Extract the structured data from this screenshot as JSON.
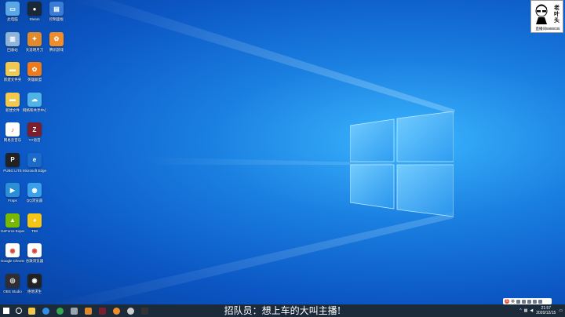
{
  "desktop_icons": [
    {
      "label": "此电脑",
      "color": "#5aa7e8",
      "glyph": "▭"
    },
    {
      "label": "Steam",
      "color": "#1b2838",
      "glyph": "●"
    },
    {
      "label": "控制面板",
      "color": "#3a7bd5",
      "glyph": "▤"
    },
    {
      "label": "回收站",
      "color": "#8fb3d9",
      "glyph": "▥"
    },
    {
      "label": "天涯明月刀",
      "color": "#e08a2c",
      "glyph": "✦"
    },
    {
      "label": "腾讯游戏",
      "color": "#f08c2a",
      "glyph": "✿"
    },
    {
      "label": "新建文件夹",
      "color": "#f2c94c",
      "glyph": "▬"
    },
    {
      "label": "英雄联盟",
      "color": "#f07a1a",
      "glyph": "✿"
    },
    {
      "label": "新建文件",
      "color": "#f2c94c",
      "glyph": "▬"
    },
    {
      "label": "网络和共享中心",
      "color": "#4fb3e8",
      "glyph": "☁"
    },
    {
      "label": "网易云音乐",
      "color": "#ffffff",
      "glyph": "♪"
    },
    {
      "label": "YY语音",
      "color": "#7a1f2e",
      "glyph": "Z"
    },
    {
      "label": "PUBG LITE",
      "color": "#222222",
      "glyph": "P"
    },
    {
      "label": "Microsoft Edge",
      "color": "#1b6ac9",
      "glyph": "e"
    },
    {
      "label": "Fraps",
      "color": "#2a8fd6",
      "glyph": "▶"
    },
    {
      "label": "QQ浏览器",
      "color": "#3aa0e8",
      "glyph": "◉"
    },
    {
      "label": "GeForce Experience",
      "color": "#76b900",
      "glyph": "▲"
    },
    {
      "label": "TIM",
      "color": "#f5c518",
      "glyph": "◕"
    },
    {
      "label": "Google Chrome",
      "color": "#ffffff",
      "glyph": "◉"
    },
    {
      "label": "谷歌浏览器",
      "color": "#ffffff",
      "glyph": "◉"
    },
    {
      "label": "OBS Studio",
      "color": "#302e31",
      "glyph": "◎"
    },
    {
      "label": "绝地求生",
      "color": "#222222",
      "glyph": "◉"
    }
  ],
  "avatar": {
    "name": "老叶头",
    "id": "直播间5988035"
  },
  "subtitle": "招队员：想上车的大叫主播!",
  "tray": {
    "time": "21:57",
    "date": "2020/12/15",
    "ime": "英"
  },
  "taskbar": {
    "apps": [
      {
        "name": "start",
        "color": "#ffffff"
      },
      {
        "name": "search",
        "color": "#ffffff"
      },
      {
        "name": "file-explorer",
        "color": "#f2c94c"
      },
      {
        "name": "edge",
        "color": "#2f8fe8"
      },
      {
        "name": "chrome",
        "color": "#34a853"
      },
      {
        "name": "steam",
        "color": "#9aa6b2"
      },
      {
        "name": "game",
        "color": "#e08a2c"
      },
      {
        "name": "video",
        "color": "#7a1f2e"
      },
      {
        "name": "tencent",
        "color": "#f08c2a"
      },
      {
        "name": "obs",
        "color": "#cccccc"
      },
      {
        "name": "pubg",
        "color": "#333333"
      }
    ]
  }
}
